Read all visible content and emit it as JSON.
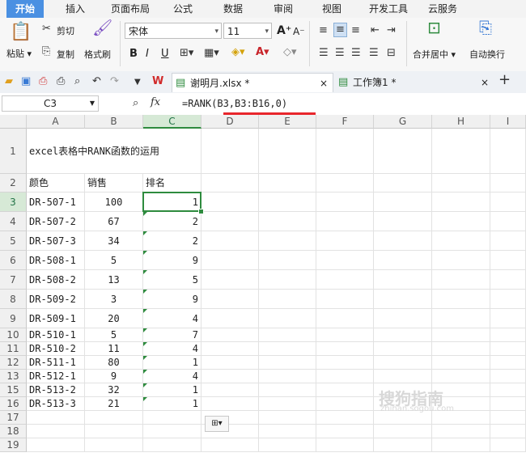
{
  "menu": {
    "tabs": [
      "开始",
      "插入",
      "页面布局",
      "公式",
      "数据",
      "审阅",
      "视图",
      "开发工具",
      "云服务"
    ],
    "active_index": 0
  },
  "ribbon": {
    "paste": "粘贴",
    "cut": "剪切",
    "copy": "复制",
    "format_painter": "格式刷",
    "font_name": "宋体",
    "font_size": "11",
    "merge_center": "合并居中",
    "wrap_text": "自动换行",
    "bold": "B",
    "italic": "I",
    "underline": "U",
    "grow_font": "A⁺",
    "shrink_font": "A⁻"
  },
  "doc_tabs": {
    "file1": "谢明月.xlsx *",
    "file2": "工作簿1 *",
    "close": "×",
    "add": "+"
  },
  "formula_bar": {
    "name_box": "C3",
    "fx": "fx",
    "formula": "=RANK(B3,B3:B16,0)"
  },
  "columns": [
    "A",
    "B",
    "C",
    "D",
    "E",
    "F",
    "G",
    "H",
    "I"
  ],
  "title_cell": "excel表格中RANK函数的运用",
  "headers": {
    "a": "颜色",
    "b": "销售",
    "c": "排名"
  },
  "rows": [
    {
      "row": "3",
      "a": "DR-507-1",
      "b": "100",
      "c": "1"
    },
    {
      "row": "4",
      "a": "DR-507-2",
      "b": "67",
      "c": "2"
    },
    {
      "row": "5",
      "a": "DR-507-3",
      "b": "34",
      "c": "2"
    },
    {
      "row": "6",
      "a": "DR-508-1",
      "b": "5",
      "c": "9"
    },
    {
      "row": "7",
      "a": "DR-508-2",
      "b": "13",
      "c": "5"
    },
    {
      "row": "8",
      "a": "DR-509-2",
      "b": "3",
      "c": "9"
    },
    {
      "row": "9",
      "a": "DR-509-1",
      "b": "20",
      "c": "4"
    },
    {
      "row": "10",
      "a": "DR-510-1",
      "b": "5",
      "c": "7"
    },
    {
      "row": "11",
      "a": "DR-510-2",
      "b": "11",
      "c": "4"
    },
    {
      "row": "12",
      "a": "DR-511-1",
      "b": "80",
      "c": "1"
    },
    {
      "row": "13",
      "a": "DR-512-1",
      "b": "9",
      "c": "4"
    },
    {
      "row": "15",
      "a": "DR-513-2",
      "b": "32",
      "c": "1"
    },
    {
      "row": "16",
      "a": "DR-513-3",
      "b": "21",
      "c": "1"
    }
  ],
  "row_labels": [
    "1",
    "2",
    "3",
    "4",
    "5",
    "6",
    "7",
    "8",
    "9",
    "10",
    "11",
    "12",
    "13",
    "15",
    "16",
    "17",
    "18",
    "19"
  ],
  "watermark": "搜狗指南",
  "watermark_sub": "zhinan.sogou.com",
  "colors": {
    "accent": "#2e8b3e",
    "tab_active": "#4a90e2",
    "underline": "#e8262c"
  }
}
